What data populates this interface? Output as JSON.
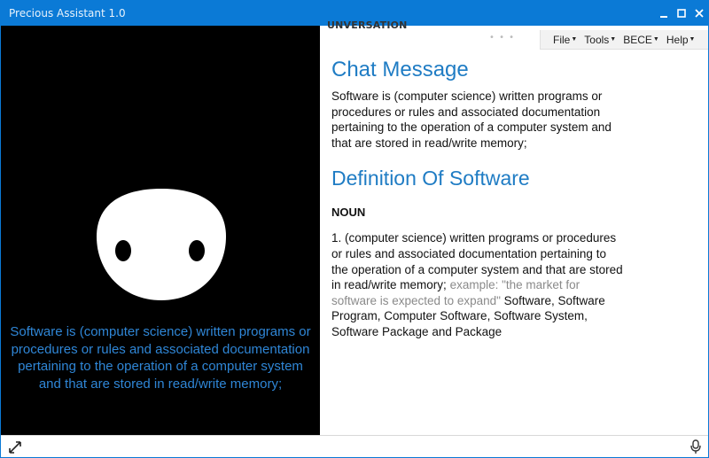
{
  "window": {
    "title": "Precious Assistant 1.0"
  },
  "left_panel": {
    "spoken_text": "Software is (computer science) written programs or procedures or rules and associated documentation pertaining to the operation of a computer system and that are stored in read/write memory;"
  },
  "right_panel": {
    "cut_header": "UNVERSATION",
    "menu": [
      {
        "label": "File"
      },
      {
        "label": "Tools"
      },
      {
        "label": "BECE"
      },
      {
        "label": "Help"
      }
    ],
    "chat": {
      "heading": "Chat Message",
      "body": "Software is (computer science) written programs or procedures or rules and associated documentation pertaining to the operation of a computer system and that are stored in read/write memory;"
    },
    "definition": {
      "heading": "Definition Of Software",
      "part_of_speech": "NOUN",
      "text": "1. (computer science) written programs or procedures or rules and associated documentation pertaining to the operation of a computer system and that are stored in read/write memory;",
      "example_label": "example:",
      "example_text": "\"the market for software is expected to expand\"",
      "synonyms": "Software, Software Program, Computer Software, Software System, Software Package and Package"
    }
  },
  "icons": {
    "expand": "expand-icon",
    "mic": "microphone-icon"
  },
  "colors": {
    "accent": "#0b7ad6",
    "heading": "#1f7cc4",
    "speech": "#2f86d6"
  }
}
